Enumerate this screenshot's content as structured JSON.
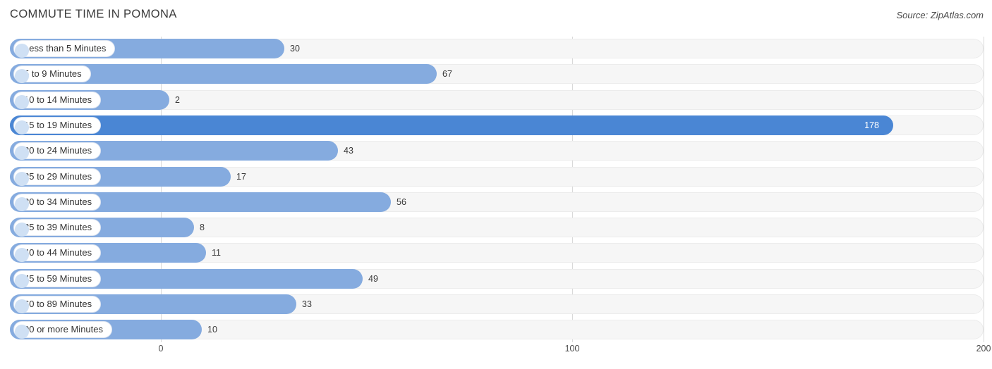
{
  "header": {
    "title": "COMMUTE TIME IN POMONA",
    "source": "Source: ZipAtlas.com"
  },
  "colors": {
    "bar": "#85abdf",
    "bar_highlight": "#4a86d4",
    "row_track": "#f6f6f6",
    "pill_bg": "#ffffff",
    "pill_dot": "#cfe0f4",
    "gridline": "#d8d8d8",
    "text": "#3a3a3a"
  },
  "chart_data": {
    "type": "bar",
    "orientation": "horizontal",
    "title": "COMMUTE TIME IN POMONA",
    "xlabel": "",
    "ylabel": "",
    "xlim": [
      0,
      200
    ],
    "grid": true,
    "ticks": [
      0,
      100,
      200
    ],
    "tick_labels": [
      "0",
      "100",
      "200"
    ],
    "legend": null,
    "categories": [
      "Less than 5 Minutes",
      "5 to 9 Minutes",
      "10 to 14 Minutes",
      "15 to 19 Minutes",
      "20 to 24 Minutes",
      "25 to 29 Minutes",
      "30 to 34 Minutes",
      "35 to 39 Minutes",
      "40 to 44 Minutes",
      "45 to 59 Minutes",
      "60 to 89 Minutes",
      "90 or more Minutes"
    ],
    "values": [
      30,
      67,
      2,
      178,
      43,
      17,
      56,
      8,
      11,
      49,
      33,
      10
    ],
    "value_labels": [
      "30",
      "67",
      "2",
      "178",
      "43",
      "17",
      "56",
      "8",
      "11",
      "49",
      "33",
      "10"
    ],
    "highlight_index": 3
  }
}
